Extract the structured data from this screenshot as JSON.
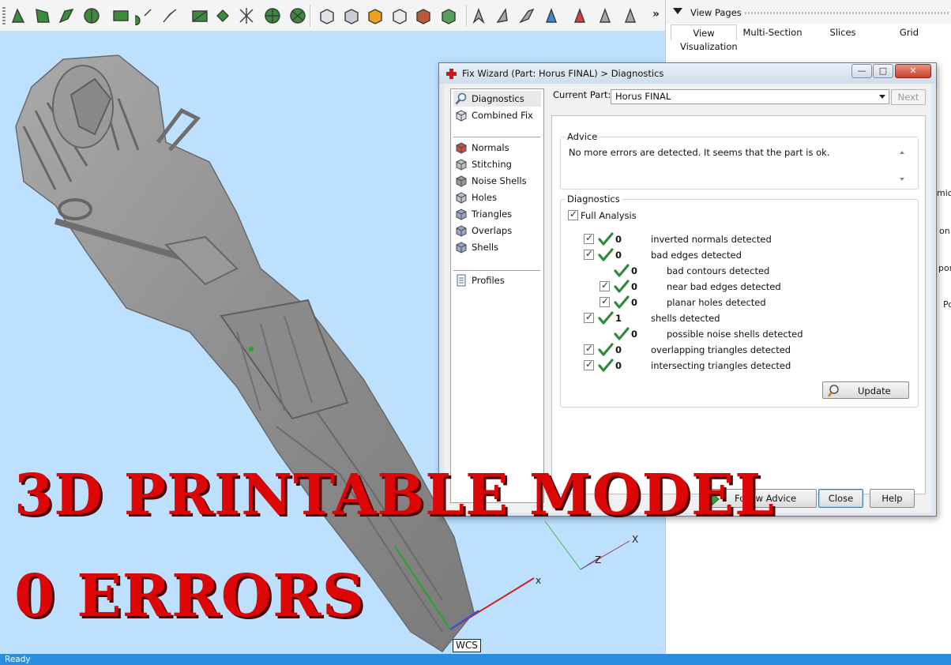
{
  "toolbar": {
    "tools": [
      {
        "name": "select-arrow-icon",
        "color": "#3c8a3c"
      },
      {
        "name": "select-area-icon",
        "color": "#3c8a3c"
      },
      {
        "name": "select-brush-icon",
        "color": "#3c8a3c"
      },
      {
        "name": "select-shell-icon",
        "color": "#3c8a3c"
      },
      {
        "name": "select-rectangle-icon",
        "color": "#3c8a3c"
      },
      {
        "name": "select-connected-icon",
        "color": "#3c8a3c"
      },
      {
        "name": "select-edge-icon",
        "color": "#3c8a3c"
      },
      {
        "name": "select-plane-icon",
        "color": "#3c8a3c"
      },
      {
        "name": "select-surface-icon",
        "color": "#3c8a3c"
      },
      {
        "name": "select-intersect-icon",
        "color": "#3c8a3c"
      },
      {
        "name": "select-wheel-icon",
        "color": "#3c8a3c"
      },
      {
        "name": "select-wheel-filled-icon",
        "color": "#3c8a3c"
      },
      {
        "name": "view-cube-white-icon",
        "color": "#dfe3e8"
      },
      {
        "name": "view-cube-grey-icon",
        "color": "#c9ced4"
      },
      {
        "name": "view-cube-color-icon",
        "color": "#f0a020"
      },
      {
        "name": "view-cube-outline-icon",
        "color": "#eaeaea"
      },
      {
        "name": "view-cube-red-icon",
        "color": "#b85a3a"
      },
      {
        "name": "view-cube-green-icon",
        "color": "#58a05a"
      },
      {
        "name": "unmark-arrow-icon",
        "color": "#a8a8a8"
      },
      {
        "name": "unmark-area-icon",
        "color": "#a8a8a8"
      },
      {
        "name": "unmark-brush-icon",
        "color": "#a8a8a8"
      },
      {
        "name": "unmark-add-icon",
        "color": "#3c8ad0"
      },
      {
        "name": "unmark-delete-icon",
        "color": "#d84040"
      },
      {
        "name": "unmark-surface-icon",
        "color": "#a8a8a8"
      },
      {
        "name": "unmark-settings-icon",
        "color": "#a8a8a8"
      }
    ],
    "overflow_glyph": "»"
  },
  "view_pages": {
    "title": "View Pages",
    "tabs": [
      "View",
      "Multi-Section",
      "Slices",
      "Grid"
    ],
    "active_tab": "View",
    "section_label": "Visualization",
    "cut_labels": [
      "mic",
      "on",
      "por",
      "Po"
    ]
  },
  "viewport": {
    "background": "#bde0ff",
    "axis_labels": {
      "x_main": "x",
      "x_secondary": "X",
      "z_secondary": "Z"
    },
    "wcs_label": "WCS",
    "overlay_line1": "3D PRINTABLE MODEL",
    "overlay_line2": "0 ERRORS",
    "overlay_color": "#dd0606"
  },
  "dialog": {
    "title": "Fix Wizard (Part: Horus FINAL) > Diagnostics",
    "window_buttons": {
      "minimize": "—",
      "maximize": "□",
      "close": "✕"
    },
    "nav": [
      {
        "label": "Diagnostics",
        "icon": "magnifier-icon",
        "selected": true
      },
      {
        "label": "Combined Fix",
        "icon": "cube-fix-icon"
      },
      {
        "label": "Normals",
        "icon": "cube-normals-icon"
      },
      {
        "label": "Stitching",
        "icon": "cube-stitch-icon"
      },
      {
        "label": "Noise Shells",
        "icon": "cube-noise-icon"
      },
      {
        "label": "Holes",
        "icon": "cube-holes-icon"
      },
      {
        "label": "Triangles",
        "icon": "cube-triangles-icon"
      },
      {
        "label": "Overlaps",
        "icon": "cube-overlaps-icon"
      },
      {
        "label": "Shells",
        "icon": "cube-shells-icon"
      },
      {
        "label": "Profiles",
        "icon": "document-icon"
      }
    ],
    "current_part_label": "Current Part:",
    "current_part_value": "Horus FINAL",
    "next_label": "Next",
    "advice_title": "Advice",
    "advice_text": "No more errors are detected. It seems that the part is ok.",
    "diagnostics_title": "Diagnostics",
    "full_analysis_label": "Full Analysis",
    "rows": [
      {
        "count": "0",
        "text": "inverted normals detected",
        "indent": 0,
        "checkbox": true
      },
      {
        "count": "0",
        "text": "bad edges detected",
        "indent": 0,
        "checkbox": true
      },
      {
        "count": "0",
        "text": "bad contours detected",
        "indent": 1,
        "checkbox": false
      },
      {
        "count": "0",
        "text": "near bad edges detected",
        "indent": 1,
        "checkbox": true
      },
      {
        "count": "0",
        "text": "planar holes detected",
        "indent": 1,
        "checkbox": true
      },
      {
        "count": "1",
        "text": "shells detected",
        "indent": 0,
        "checkbox": true
      },
      {
        "count": "0",
        "text": "possible noise shells detected",
        "indent": 1,
        "checkbox": false
      },
      {
        "count": "0",
        "text": "overlapping triangles detected",
        "indent": 0,
        "checkbox": true
      },
      {
        "count": "0",
        "text": "intersecting triangles detected",
        "indent": 0,
        "checkbox": true
      }
    ],
    "update_label": "Update",
    "follow_advice_label": "Follow Advice",
    "close_label": "Close",
    "help_label": "Help",
    "tick_color": "#2f8a3a"
  },
  "status": {
    "text": "Ready",
    "color": "#2a8ee0"
  }
}
